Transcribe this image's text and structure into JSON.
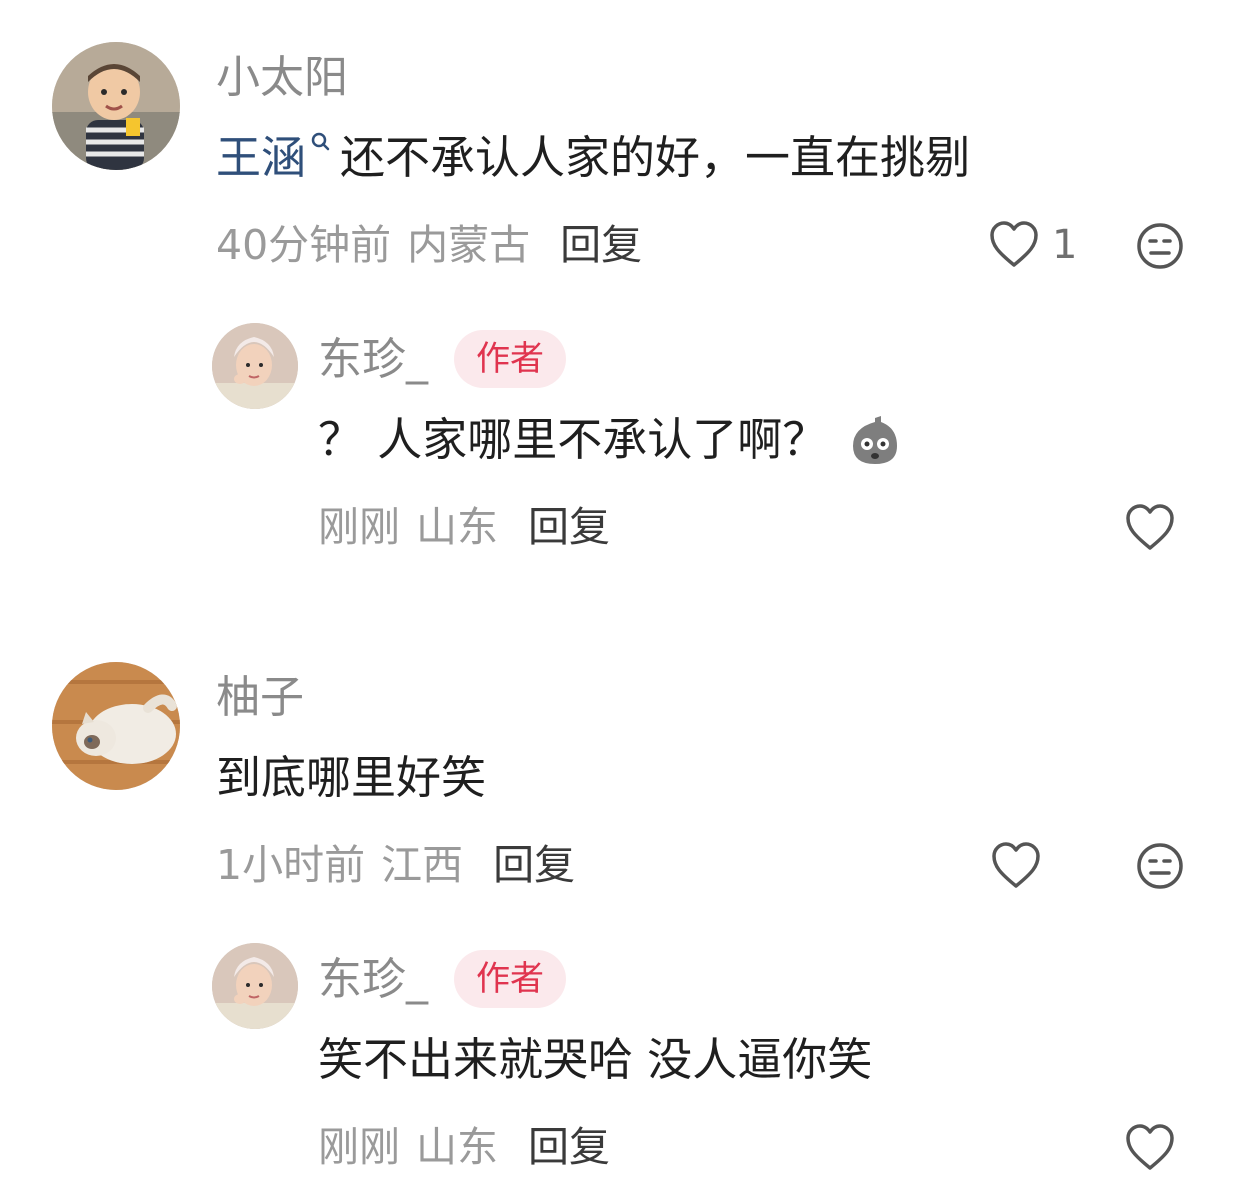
{
  "comments": [
    {
      "user": "小太阳",
      "mention": "王涵",
      "text": "还不承认人家的好，一直在挑剔",
      "time": "40分钟前",
      "location": "内蒙古",
      "reply_label": "回复",
      "like_count": "1",
      "replies": [
        {
          "user": "东珍_",
          "badge": "作者",
          "text": "？ 人家哪里不承认了啊？",
          "emoji": "surprised-sticker",
          "time": "刚刚",
          "location": "山东",
          "reply_label": "回复"
        }
      ]
    },
    {
      "user": "柚子",
      "text": "到底哪里好笑",
      "time": "1小时前",
      "location": "江西",
      "reply_label": "回复",
      "like_count": "",
      "replies": [
        {
          "user": "东珍_",
          "badge": "作者",
          "text": "笑不出来就哭哈 没人逼你笑",
          "time": "刚刚",
          "location": "山东",
          "reply_label": "回复"
        }
      ]
    }
  ],
  "colors": {
    "name": "#8a8a8a",
    "text": "#1f1f1f",
    "mention": "#2f4f7a",
    "badge_bg": "#fbe9ec",
    "badge_text": "#e0344f",
    "icon": "#555555"
  },
  "icons": [
    "heart-outline-icon",
    "unamused-face-icon",
    "search-icon"
  ]
}
